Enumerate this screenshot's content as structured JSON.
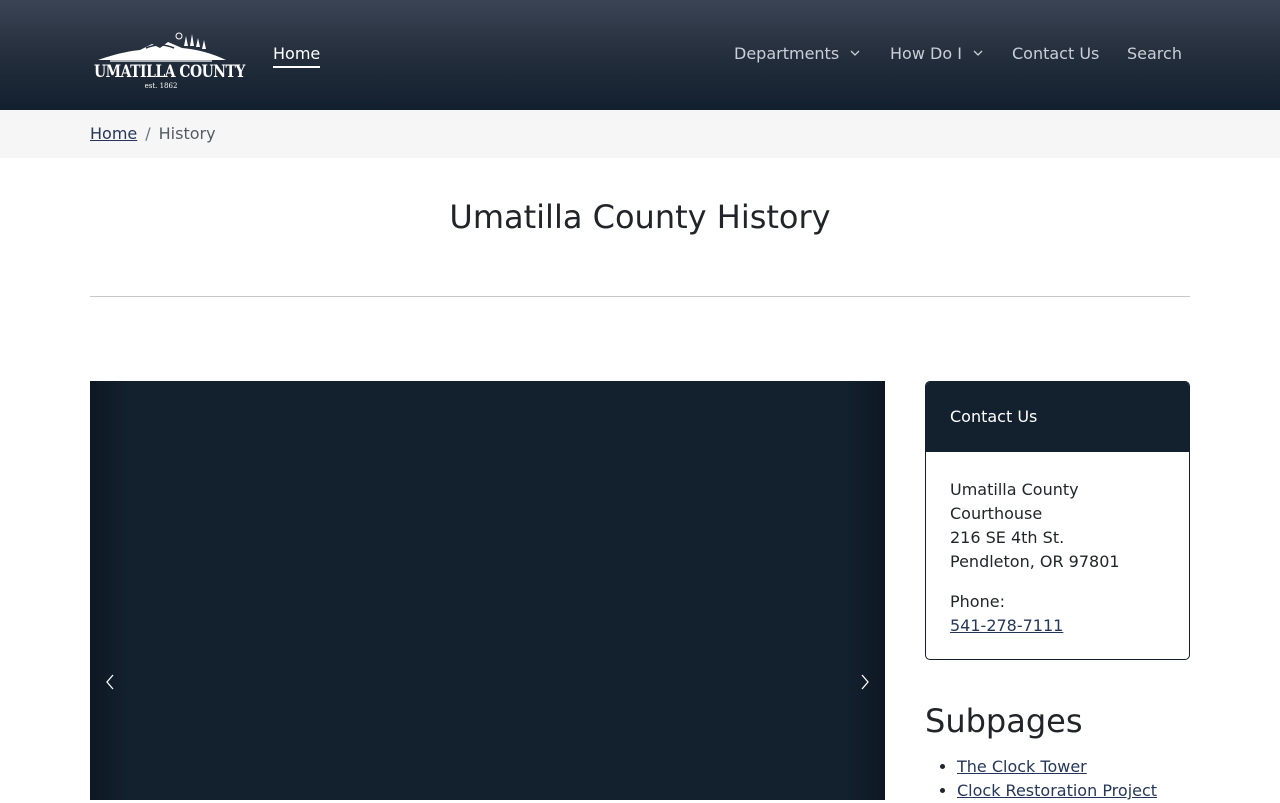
{
  "header": {
    "logo": {
      "name": "UMATILLA COUNTY",
      "established": "est. 1862"
    },
    "nav": {
      "home": "Home",
      "departments": "Departments",
      "how_do_i": "How Do I",
      "contact": "Contact Us",
      "search": "Search"
    }
  },
  "breadcrumb": {
    "home": "Home",
    "separator": "/",
    "current": "History"
  },
  "page": {
    "title": "Umatilla County History"
  },
  "carousel": {
    "prev_icon": "chevron-left-icon",
    "next_icon": "chevron-right-icon"
  },
  "contact_card": {
    "heading": "Contact Us",
    "address_line1": "Umatilla County",
    "address_line2": "Courthouse",
    "address_line3": "216 SE 4th St.",
    "address_line4": "Pendleton, OR 97801",
    "phone_label": "Phone:",
    "phone": "541-278-7111"
  },
  "subpages": {
    "heading": "Subpages",
    "items": [
      {
        "label": "The Clock Tower"
      },
      {
        "label": "Clock Restoration Project"
      }
    ]
  },
  "colors": {
    "header_dark": "#121f2e",
    "header_light": "#3a4454",
    "link": "#24365a",
    "breadcrumb_bg": "#f6f6f6"
  }
}
